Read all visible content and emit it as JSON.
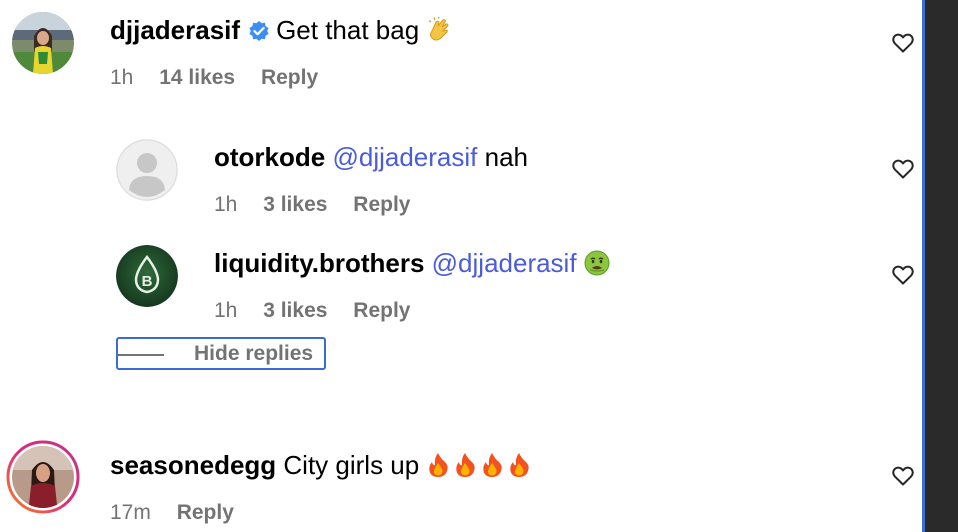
{
  "comments": [
    {
      "username": "djjaderasif",
      "verified": true,
      "text": "Get that bag",
      "emoji": "clapping-hands",
      "time": "1h",
      "likes": "14 likes",
      "reply": "Reply",
      "replies": [
        {
          "username": "otorkode",
          "mention": "@djjaderasif",
          "text": "nah",
          "time": "1h",
          "likes": "3 likes",
          "reply": "Reply"
        },
        {
          "username": "liquidity.brothers",
          "mention": "@djjaderasif",
          "text": "",
          "emoji": "nauseated-face",
          "time": "1h",
          "likes": "3 likes",
          "reply": "Reply"
        }
      ],
      "hide_replies": "Hide replies"
    },
    {
      "username": "seasonedegg",
      "text": "City girls up",
      "emoji": "fire x4",
      "time": "17m",
      "reply": "Reply"
    }
  ],
  "colors": {
    "mention": "#4a5bdc",
    "meta": "#737373",
    "verified": "#3a8ef6",
    "focus_ring": "#3b6bd6",
    "story_ring_start": "#f58529",
    "story_ring_end": "#dd2a7b"
  },
  "icons": [
    "heart-icon",
    "verified-badge-icon",
    "default-avatar-icon",
    "liquidity-logo-icon"
  ]
}
